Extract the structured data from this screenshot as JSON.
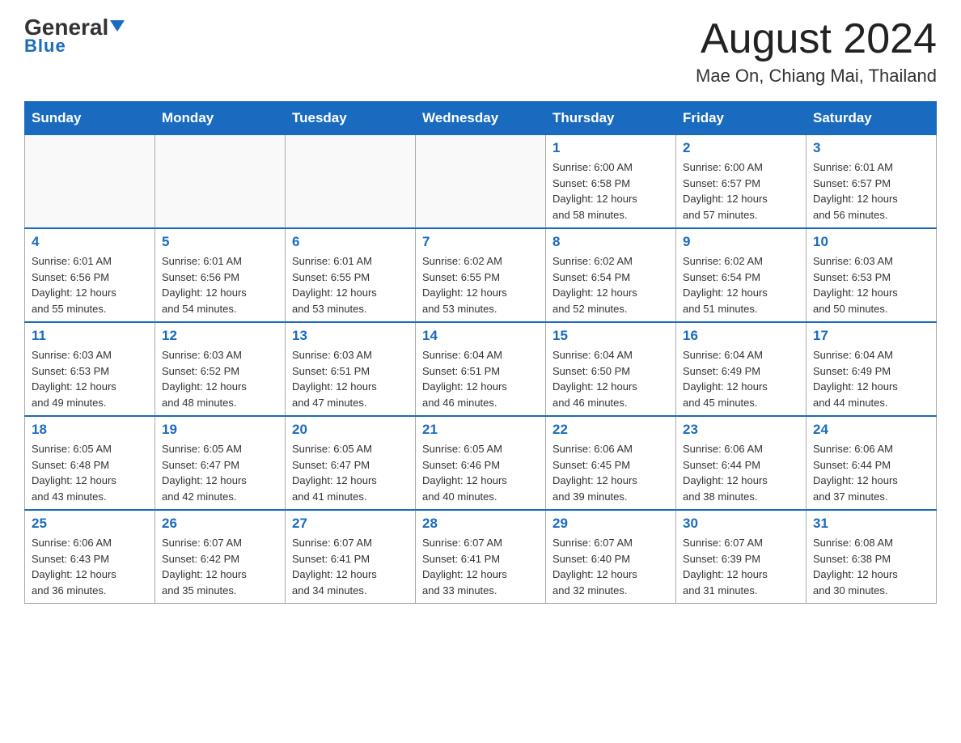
{
  "header": {
    "logo_general": "General",
    "logo_blue": "Blue",
    "month_title": "August 2024",
    "location": "Mae On, Chiang Mai, Thailand"
  },
  "weekdays": [
    "Sunday",
    "Monday",
    "Tuesday",
    "Wednesday",
    "Thursday",
    "Friday",
    "Saturday"
  ],
  "weeks": [
    [
      {
        "day": "",
        "info": ""
      },
      {
        "day": "",
        "info": ""
      },
      {
        "day": "",
        "info": ""
      },
      {
        "day": "",
        "info": ""
      },
      {
        "day": "1",
        "info": "Sunrise: 6:00 AM\nSunset: 6:58 PM\nDaylight: 12 hours\nand 58 minutes."
      },
      {
        "day": "2",
        "info": "Sunrise: 6:00 AM\nSunset: 6:57 PM\nDaylight: 12 hours\nand 57 minutes."
      },
      {
        "day": "3",
        "info": "Sunrise: 6:01 AM\nSunset: 6:57 PM\nDaylight: 12 hours\nand 56 minutes."
      }
    ],
    [
      {
        "day": "4",
        "info": "Sunrise: 6:01 AM\nSunset: 6:56 PM\nDaylight: 12 hours\nand 55 minutes."
      },
      {
        "day": "5",
        "info": "Sunrise: 6:01 AM\nSunset: 6:56 PM\nDaylight: 12 hours\nand 54 minutes."
      },
      {
        "day": "6",
        "info": "Sunrise: 6:01 AM\nSunset: 6:55 PM\nDaylight: 12 hours\nand 53 minutes."
      },
      {
        "day": "7",
        "info": "Sunrise: 6:02 AM\nSunset: 6:55 PM\nDaylight: 12 hours\nand 53 minutes."
      },
      {
        "day": "8",
        "info": "Sunrise: 6:02 AM\nSunset: 6:54 PM\nDaylight: 12 hours\nand 52 minutes."
      },
      {
        "day": "9",
        "info": "Sunrise: 6:02 AM\nSunset: 6:54 PM\nDaylight: 12 hours\nand 51 minutes."
      },
      {
        "day": "10",
        "info": "Sunrise: 6:03 AM\nSunset: 6:53 PM\nDaylight: 12 hours\nand 50 minutes."
      }
    ],
    [
      {
        "day": "11",
        "info": "Sunrise: 6:03 AM\nSunset: 6:53 PM\nDaylight: 12 hours\nand 49 minutes."
      },
      {
        "day": "12",
        "info": "Sunrise: 6:03 AM\nSunset: 6:52 PM\nDaylight: 12 hours\nand 48 minutes."
      },
      {
        "day": "13",
        "info": "Sunrise: 6:03 AM\nSunset: 6:51 PM\nDaylight: 12 hours\nand 47 minutes."
      },
      {
        "day": "14",
        "info": "Sunrise: 6:04 AM\nSunset: 6:51 PM\nDaylight: 12 hours\nand 46 minutes."
      },
      {
        "day": "15",
        "info": "Sunrise: 6:04 AM\nSunset: 6:50 PM\nDaylight: 12 hours\nand 46 minutes."
      },
      {
        "day": "16",
        "info": "Sunrise: 6:04 AM\nSunset: 6:49 PM\nDaylight: 12 hours\nand 45 minutes."
      },
      {
        "day": "17",
        "info": "Sunrise: 6:04 AM\nSunset: 6:49 PM\nDaylight: 12 hours\nand 44 minutes."
      }
    ],
    [
      {
        "day": "18",
        "info": "Sunrise: 6:05 AM\nSunset: 6:48 PM\nDaylight: 12 hours\nand 43 minutes."
      },
      {
        "day": "19",
        "info": "Sunrise: 6:05 AM\nSunset: 6:47 PM\nDaylight: 12 hours\nand 42 minutes."
      },
      {
        "day": "20",
        "info": "Sunrise: 6:05 AM\nSunset: 6:47 PM\nDaylight: 12 hours\nand 41 minutes."
      },
      {
        "day": "21",
        "info": "Sunrise: 6:05 AM\nSunset: 6:46 PM\nDaylight: 12 hours\nand 40 minutes."
      },
      {
        "day": "22",
        "info": "Sunrise: 6:06 AM\nSunset: 6:45 PM\nDaylight: 12 hours\nand 39 minutes."
      },
      {
        "day": "23",
        "info": "Sunrise: 6:06 AM\nSunset: 6:44 PM\nDaylight: 12 hours\nand 38 minutes."
      },
      {
        "day": "24",
        "info": "Sunrise: 6:06 AM\nSunset: 6:44 PM\nDaylight: 12 hours\nand 37 minutes."
      }
    ],
    [
      {
        "day": "25",
        "info": "Sunrise: 6:06 AM\nSunset: 6:43 PM\nDaylight: 12 hours\nand 36 minutes."
      },
      {
        "day": "26",
        "info": "Sunrise: 6:07 AM\nSunset: 6:42 PM\nDaylight: 12 hours\nand 35 minutes."
      },
      {
        "day": "27",
        "info": "Sunrise: 6:07 AM\nSunset: 6:41 PM\nDaylight: 12 hours\nand 34 minutes."
      },
      {
        "day": "28",
        "info": "Sunrise: 6:07 AM\nSunset: 6:41 PM\nDaylight: 12 hours\nand 33 minutes."
      },
      {
        "day": "29",
        "info": "Sunrise: 6:07 AM\nSunset: 6:40 PM\nDaylight: 12 hours\nand 32 minutes."
      },
      {
        "day": "30",
        "info": "Sunrise: 6:07 AM\nSunset: 6:39 PM\nDaylight: 12 hours\nand 31 minutes."
      },
      {
        "day": "31",
        "info": "Sunrise: 6:08 AM\nSunset: 6:38 PM\nDaylight: 12 hours\nand 30 minutes."
      }
    ]
  ]
}
